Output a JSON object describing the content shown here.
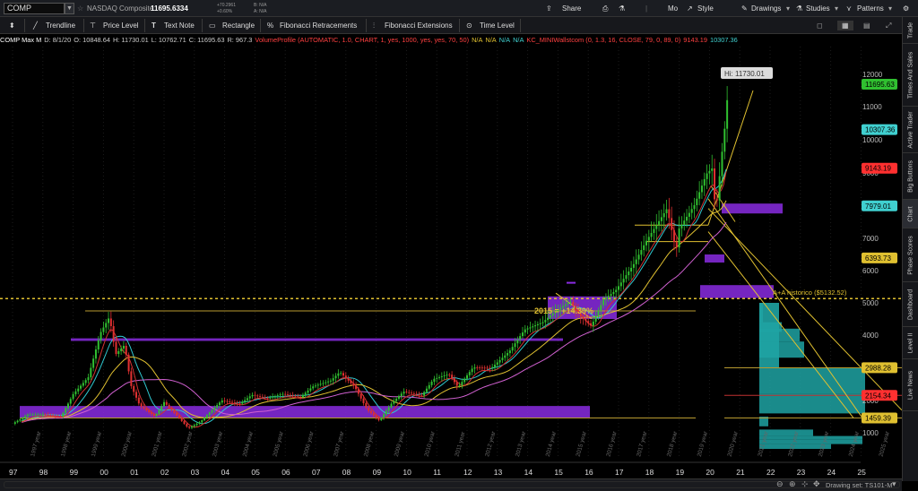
{
  "topbar": {
    "symbol": "COMP",
    "symbol_name": "NASDAQ Composite",
    "last_price": "11695.6334",
    "net_change": "+70.2961",
    "pct_change": "+0.60%",
    "bid": "B: N/A",
    "ask": "A: N/A",
    "share": "Share",
    "period": "Mo",
    "style": "Style",
    "drawings": "Drawings",
    "studies": "Studies",
    "patterns": "Patterns"
  },
  "drawbar": {
    "tools": [
      "Trendline",
      "Price Level",
      "Text Note",
      "Rectangle",
      "Fibonacci Retracements",
      "Fibonacci Extensions",
      "Time Level"
    ]
  },
  "header": {
    "items": [
      {
        "text": "COMP Max M",
        "color": "#ffffff"
      },
      {
        "text": "D: 8/1/20",
        "color": "#cccccc"
      },
      {
        "text": "O: 10848.64",
        "color": "#cccccc"
      },
      {
        "text": "H: 11730.01",
        "color": "#cccccc"
      },
      {
        "text": "L: 10762.71",
        "color": "#cccccc"
      },
      {
        "text": "C: 11695.63",
        "color": "#cccccc"
      },
      {
        "text": "R: 967.3",
        "color": "#cccccc"
      },
      {
        "text": "VolumeProfile (AUTOMATIC, 1.0, CHART, 1, yes, 1000, yes, yes, 70, 50)",
        "color": "#ff4040"
      },
      {
        "text": "N/A",
        "color": "#e0c030"
      },
      {
        "text": "N/A",
        "color": "#e0c030"
      },
      {
        "text": "N/A",
        "color": "#40d0d0"
      },
      {
        "text": "N/A",
        "color": "#40d0d0"
      },
      {
        "text": "KC_MINIWallstcom (0, 1.3, 16, CLOSE, 79, 0, 89, 0)",
        "color": "#ff4040"
      },
      {
        "text": "9143.19",
        "color": "#ff4040"
      },
      {
        "text": "10307.36",
        "color": "#40d0d0"
      }
    ]
  },
  "sidebar": {
    "items": [
      "Trade",
      "Times And Sales",
      "Active Trader",
      "Big Buttons",
      "Chart",
      "Phase Scores",
      "Dashboard",
      "Level II",
      "Live News"
    ]
  },
  "chart": {
    "hi_label": "Hi: 11730.01",
    "annotation_ath": "A+A historico ($5132.52)",
    "annotation_2015": "2015 = +14.39%",
    "price_ticks": [
      "12000",
      "11000",
      "10000",
      "9000",
      "8000",
      "7000",
      "6000",
      "5000",
      "4000",
      "3000",
      "2000",
      "1000"
    ],
    "price_bubbles": [
      {
        "value": "11695.63",
        "bg": "#30c030",
        "fg": "#000000"
      },
      {
        "value": "10307.36",
        "bg": "#40d0d0",
        "fg": "#000000"
      },
      {
        "value": "9143.19",
        "bg": "#ff3030",
        "fg": "#000000"
      },
      {
        "value": "7979.01",
        "bg": "#40d0d0",
        "fg": "#000000"
      },
      {
        "value": "6393.73",
        "bg": "#e0c030",
        "fg": "#000000"
      },
      {
        "value": "2988.28",
        "bg": "#e0c030",
        "fg": "#000000"
      },
      {
        "value": "2154.34",
        "bg": "#ff3030",
        "fg": "#000000"
      },
      {
        "value": "1459.39",
        "bg": "#e0c030",
        "fg": "#000000"
      }
    ],
    "x_ticks": [
      "97",
      "98",
      "99",
      "00",
      "01",
      "02",
      "03",
      "04",
      "05",
      "06",
      "07",
      "08",
      "09",
      "10",
      "11",
      "12",
      "13",
      "14",
      "15",
      "16",
      "17",
      "18",
      "19",
      "20",
      "21",
      "22",
      "23",
      "24",
      "25"
    ],
    "year_labels": [
      "1997 year",
      "1998 year",
      "1999 year",
      "2000 year",
      "2001 year",
      "2002 year",
      "2003 year",
      "2004 year",
      "2005 year",
      "2006 year",
      "2007 year",
      "2008 year",
      "2009 year",
      "2010 year",
      "2011 year",
      "2012 year",
      "2013 year",
      "2014 year",
      "2015 year",
      "2016 year",
      "2017 year",
      "2018 year",
      "2019 year",
      "2020 year",
      "2021 year",
      "2022 year",
      "2023 year",
      "2024 year",
      "2025 year"
    ]
  },
  "status": {
    "drawing_set": "Drawing set: TS101-M"
  },
  "colors": {
    "up_candle": "#30c030",
    "down_candle": "#e03030",
    "zone": "#8a2be2",
    "volume_profile": "#1fa3a3",
    "ma_cyan": "#2fc8d0",
    "ma_yellow": "#e0c030",
    "ma_pink": "#d060d0"
  }
}
